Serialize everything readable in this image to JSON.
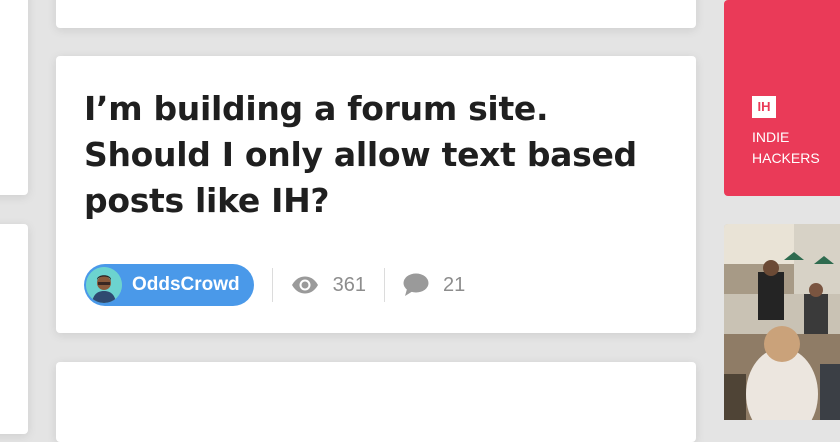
{
  "post": {
    "title": "I’m building a forum site. Should I only allow text based posts like IH?",
    "author": "OddsCrowd",
    "views": "361",
    "comments": "21"
  },
  "sidebar": {
    "logo_text": "IH",
    "brand_line1": "INDIE",
    "brand_line2": "HACKERS"
  },
  "colors": {
    "brand": "#ea3a58",
    "author_pill": "#4a99e9",
    "stat_text": "#8d8d8d"
  },
  "icons": [
    "eye-icon",
    "comment-icon"
  ]
}
